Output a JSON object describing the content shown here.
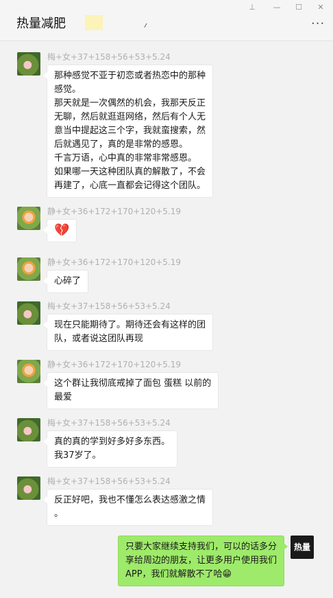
{
  "header": {
    "title": "热量减肥",
    "window_controls": [
      "pin-icon",
      "minimize-icon",
      "maximize-icon",
      "close-icon"
    ],
    "more_icon": "more-icon"
  },
  "messages": [
    {
      "name": "梅+女+37+158+56+53+5.24",
      "avatar": "flower",
      "lines": [
        "那种感觉不亚于初恋或者热恋中的那种",
        "感觉。",
        "那天就是一次偶然的机会，我那天反正",
        "无聊，然后就逛逛网络，然后有个人无",
        "意当中提起这三个字，我就蛮搜索，然",
        "后就遇见了，真的是非常的感恩。",
        "千言万语，心中真的非常非常感恩。",
        "如果哪一天这种团队真的解散了，不会",
        "再建了，心底一直都会记得这个团队。"
      ]
    },
    {
      "name": "静+女+36+172+170+120+5.19",
      "avatar": "child",
      "emoji": "broken-heart-emoji",
      "lines": [
        "💔"
      ]
    },
    {
      "name": "静+女+36+172+170+120+5.19",
      "avatar": "child",
      "lines": [
        "心碎了"
      ]
    },
    {
      "name": "梅+女+37+158+56+53+5.24",
      "avatar": "flower",
      "lines": [
        "现在只能期待了。期待还会有这样的团",
        "队，或者说这团队再现"
      ]
    },
    {
      "name": "静+女+36+172+170+120+5.19",
      "avatar": "child",
      "lines": [
        "这个群让我彻底戒掉了面包 蛋糕 以前的",
        "最爱"
      ]
    },
    {
      "name": "梅+女+37+158+56+53+5.24",
      "avatar": "flower",
      "lines": [
        "真的真的学到好多好多东西。",
        "我37岁了。"
      ]
    },
    {
      "name": "梅+女+37+158+56+53+5.24",
      "avatar": "flower",
      "lines": [
        "反正好吧，我也不懂怎么表达感激之情",
        "。"
      ]
    }
  ],
  "self_message": {
    "avatar_text": "热量",
    "lines": [
      "只要大家继续支持我们，可以的话多分",
      "享给周边的朋友，让更多用户使用我们",
      "APP，我们就解散不了哈😁"
    ]
  }
}
